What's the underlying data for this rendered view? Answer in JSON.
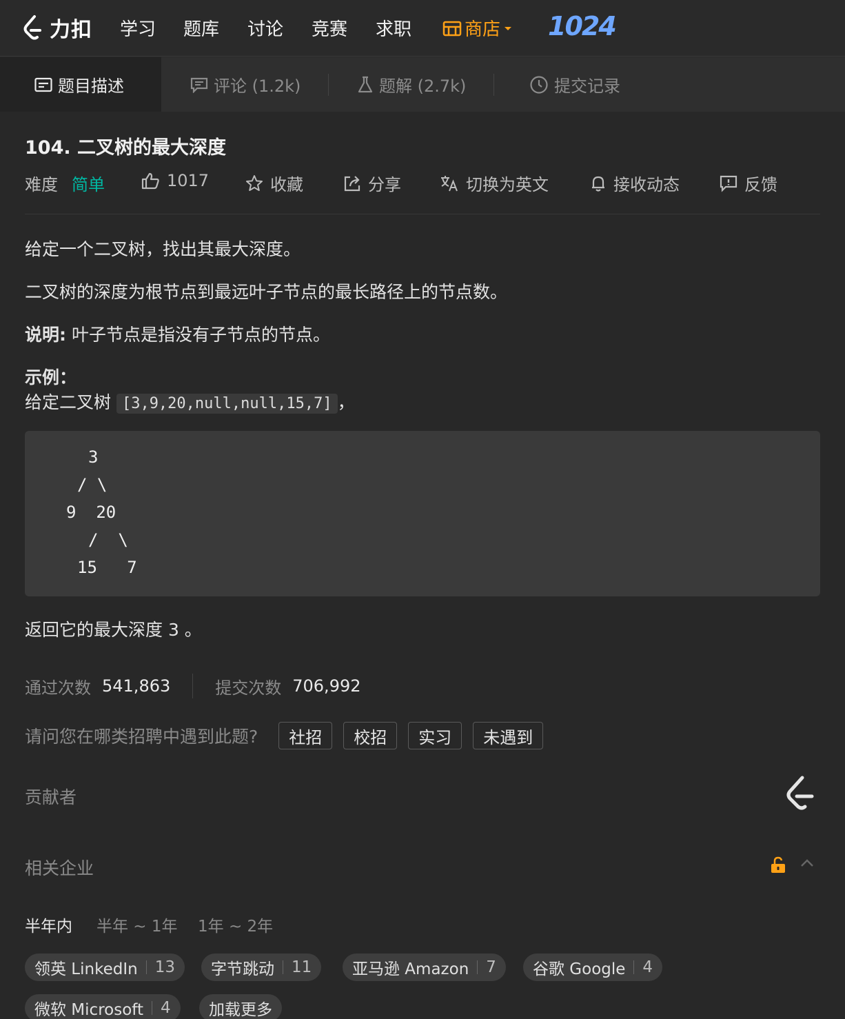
{
  "nav": {
    "logo_text": "力扣",
    "items": [
      "学习",
      "题库",
      "讨论",
      "竞赛",
      "求职"
    ],
    "store": "商店",
    "badge": "1024"
  },
  "tabs": [
    {
      "label": "题目描述",
      "icon": "description-icon"
    },
    {
      "label": "评论 (1.2k)",
      "icon": "comment-icon"
    },
    {
      "label": "题解 (2.7k)",
      "icon": "flask-icon"
    },
    {
      "label": "提交记录",
      "icon": "clock-icon"
    }
  ],
  "problem": {
    "title": "104. 二叉树的最大深度",
    "difficulty_label": "难度",
    "difficulty": "简单",
    "likes": "1017",
    "favorite": "收藏",
    "share": "分享",
    "translate": "切换为英文",
    "subscribe": "接收动态",
    "feedback": "反馈"
  },
  "description": {
    "p1": "给定一个二叉树，找出其最大深度。",
    "p2": "二叉树的深度为根节点到最远叶子节点的最长路径上的节点数。",
    "note_label": "说明:",
    "note": " 叶子节点是指没有子节点的节点。",
    "example_label": "示例：",
    "example_prefix": "给定二叉树 ",
    "example_code": "[3,9,20,null,null,15,7]",
    "example_suffix": "，",
    "tree_lines": [
      "3",
      "/ \\",
      "9  20",
      "/  \\",
      "15   7"
    ],
    "result": "返回它的最大深度 3 。"
  },
  "stats": {
    "accepted_label": "通过次数",
    "accepted": "541,863",
    "submissions_label": "提交次数",
    "submissions": "706,992"
  },
  "recruit": {
    "question": "请问您在哪类招聘中遇到此题?",
    "options": [
      "社招",
      "校招",
      "实习",
      "未遇到"
    ]
  },
  "contributors_label": "贡献者",
  "companies": {
    "title": "相关企业",
    "ranges": [
      "半年内",
      "半年 ~ 1年",
      "1年 ~ 2年"
    ],
    "items": [
      {
        "name": "领英 LinkedIn",
        "count": "13"
      },
      {
        "name": "字节跳动",
        "count": "11"
      },
      {
        "name": "亚马逊 Amazon",
        "count": "7"
      },
      {
        "name": "谷歌 Google",
        "count": "4"
      },
      {
        "name": "微软 Microsoft",
        "count": "4"
      }
    ],
    "load_more": "加载更多"
  },
  "colors": {
    "accent": "#ffa116",
    "easy": "#00b8a3",
    "background": "#282828"
  }
}
